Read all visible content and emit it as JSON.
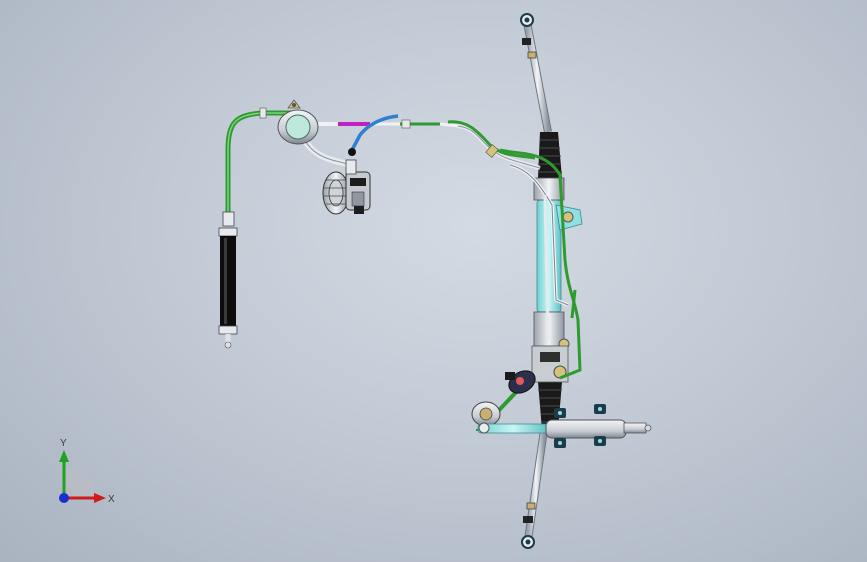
{
  "viewport": {
    "background_top": "#d3dae3",
    "background_bottom": "#a9b3c0"
  },
  "model": {
    "parts": [
      "steering-rack",
      "tie-rod-top",
      "tie-rod-bottom",
      "power-steering-pump",
      "reservoir",
      "hydraulic-hose",
      "oil-cooler",
      "steering-damper",
      "pinion-valve"
    ],
    "colors": {
      "green_hose": "#2f9a2f",
      "cyan_tube": "#8fe0e0",
      "blue_hose": "#2f7fd0",
      "magenta_hose": "#c020c0",
      "metal": "#d8dde3",
      "dark": "#111111"
    }
  },
  "triad": {
    "y_label": "Y",
    "x_label": "X",
    "y_color": "#1fa21f",
    "x_color": "#d11a1a",
    "z_color": "#1a2fd1"
  }
}
